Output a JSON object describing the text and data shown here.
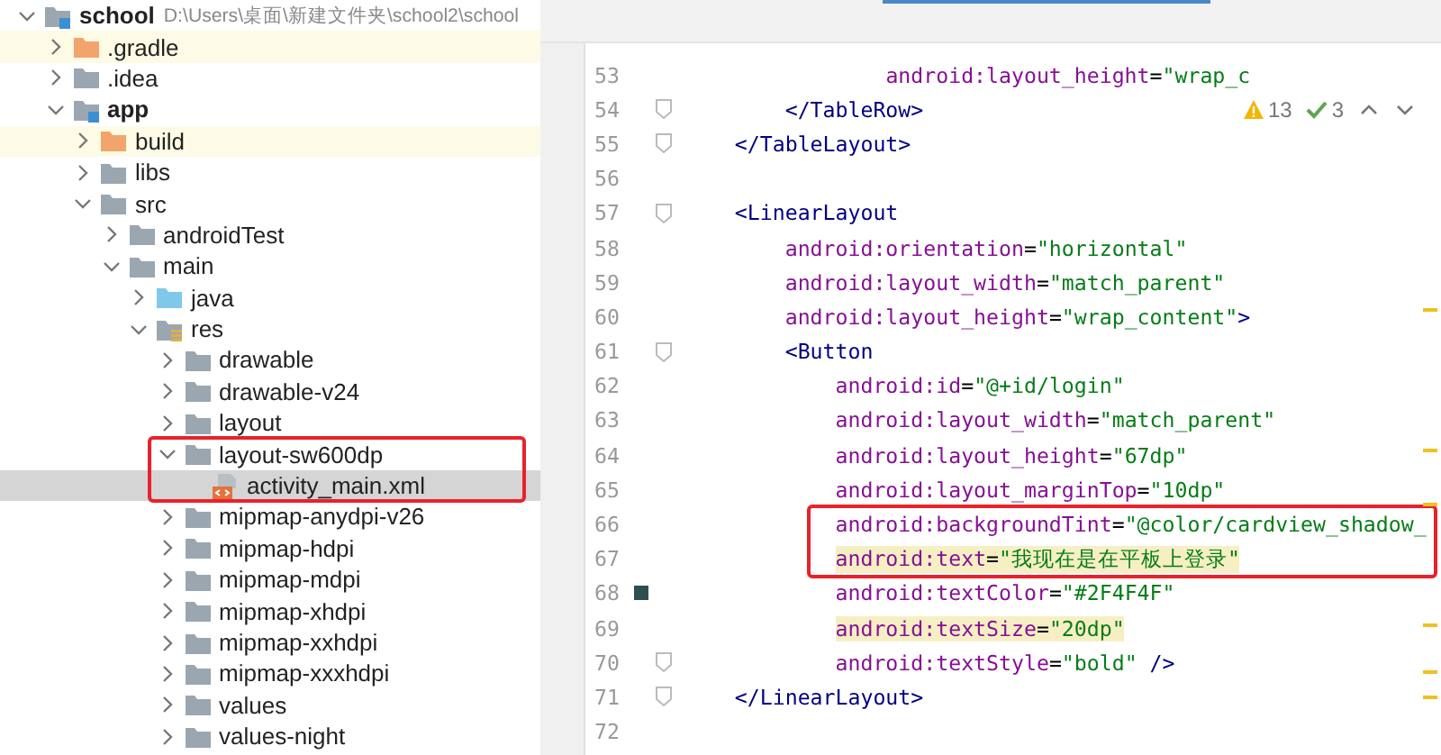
{
  "project_tree": [
    {
      "label": "school",
      "kind": "module",
      "path": "D:\\Users\\桌面\\新建文件夹\\school2\\school",
      "expanded": true,
      "selected": false,
      "children": [
        {
          "label": ".gradle",
          "kind": "excluded",
          "expanded": false,
          "selected": false
        },
        {
          "label": ".idea",
          "kind": "folder",
          "expanded": false,
          "selected": false
        },
        {
          "label": "app",
          "kind": "module",
          "expanded": true,
          "selected": false,
          "children": [
            {
              "label": "build",
              "kind": "excluded",
              "expanded": false,
              "selected": false
            },
            {
              "label": "libs",
              "kind": "folder",
              "expanded": false,
              "selected": false
            },
            {
              "label": "src",
              "kind": "folder",
              "expanded": true,
              "selected": false,
              "children": [
                {
                  "label": "androidTest",
                  "kind": "folder",
                  "expanded": false,
                  "selected": false
                },
                {
                  "label": "main",
                  "kind": "folder",
                  "expanded": true,
                  "selected": false,
                  "children": [
                    {
                      "label": "java",
                      "kind": "source",
                      "expanded": false,
                      "selected": false
                    },
                    {
                      "label": "res",
                      "kind": "resources",
                      "expanded": true,
                      "selected": false,
                      "children": [
                        {
                          "label": "drawable",
                          "kind": "folder",
                          "expanded": false,
                          "selected": false
                        },
                        {
                          "label": "drawable-v24",
                          "kind": "folder",
                          "expanded": false,
                          "selected": false
                        },
                        {
                          "label": "layout",
                          "kind": "folder",
                          "expanded": false,
                          "selected": false
                        },
                        {
                          "label": "layout-sw600dp",
                          "kind": "folder",
                          "expanded": true,
                          "selected": false,
                          "annotated": true,
                          "children": [
                            {
                              "label": "activity_main.xml",
                              "kind": "xml",
                              "selected": true
                            }
                          ]
                        },
                        {
                          "label": "mipmap-anydpi-v26",
                          "kind": "folder",
                          "expanded": false,
                          "selected": false
                        },
                        {
                          "label": "mipmap-hdpi",
                          "kind": "folder",
                          "expanded": false,
                          "selected": false
                        },
                        {
                          "label": "mipmap-mdpi",
                          "kind": "folder",
                          "expanded": false,
                          "selected": false
                        },
                        {
                          "label": "mipmap-xhdpi",
                          "kind": "folder",
                          "expanded": false,
                          "selected": false
                        },
                        {
                          "label": "mipmap-xxhdpi",
                          "kind": "folder",
                          "expanded": false,
                          "selected": false
                        },
                        {
                          "label": "mipmap-xxxhdpi",
                          "kind": "folder",
                          "expanded": false,
                          "selected": false
                        },
                        {
                          "label": "values",
                          "kind": "folder",
                          "expanded": false,
                          "selected": false
                        },
                        {
                          "label": "values-night",
                          "kind": "folder",
                          "expanded": false,
                          "selected": false
                        }
                      ]
                    }
                  ]
                }
              ]
            }
          ]
        }
      ]
    }
  ],
  "editor": {
    "inspections": {
      "warnings": "13",
      "typos": "3"
    },
    "lines": [
      {
        "number": "53",
        "highlighted": false,
        "segments": [
          {
            "kind": "attr",
            "text": "                android:layout_height"
          },
          {
            "kind": "punct",
            "text": "="
          },
          {
            "kind": "value",
            "text": "\"wrap_c"
          }
        ]
      },
      {
        "number": "54",
        "fold": true,
        "highlighted": false,
        "segments": [
          {
            "kind": "tag",
            "text": "        </TableRow>"
          }
        ]
      },
      {
        "number": "55",
        "fold": true,
        "highlighted": false,
        "segments": [
          {
            "kind": "tag",
            "text": "    </TableLayout>"
          }
        ]
      },
      {
        "number": "56"
      },
      {
        "number": "57",
        "fold": true,
        "highlighted": false,
        "segments": [
          {
            "kind": "tag",
            "text": "    <LinearLayout"
          }
        ]
      },
      {
        "number": "58",
        "highlighted": false,
        "segments": [
          {
            "kind": "attr",
            "text": "        android:orientation"
          },
          {
            "kind": "punct",
            "text": "="
          },
          {
            "kind": "value",
            "text": "\"horizontal\""
          }
        ]
      },
      {
        "number": "59",
        "highlighted": false,
        "segments": [
          {
            "kind": "attr",
            "text": "        android:layout_width"
          },
          {
            "kind": "punct",
            "text": "="
          },
          {
            "kind": "value",
            "text": "\"match_parent\""
          }
        ]
      },
      {
        "number": "60",
        "highlighted": false,
        "segments": [
          {
            "kind": "attr",
            "text": "        android:layout_height"
          },
          {
            "kind": "punct",
            "text": "="
          },
          {
            "kind": "value",
            "text": "\"wrap_content\""
          },
          {
            "kind": "tag",
            "text": ">"
          }
        ]
      },
      {
        "number": "61",
        "fold": true,
        "highlighted": false,
        "segments": [
          {
            "kind": "tag",
            "text": "        <Button"
          }
        ]
      },
      {
        "number": "62",
        "highlighted": false,
        "segments": [
          {
            "kind": "attr",
            "text": "            android:id"
          },
          {
            "kind": "punct",
            "text": "="
          },
          {
            "kind": "value",
            "text": "\"@+id/login\""
          }
        ]
      },
      {
        "number": "63",
        "highlighted": false,
        "segments": [
          {
            "kind": "attr",
            "text": "            android:layout_width"
          },
          {
            "kind": "punct",
            "text": "="
          },
          {
            "kind": "value",
            "text": "\"match_parent\""
          }
        ]
      },
      {
        "number": "64",
        "highlighted": false,
        "segments": [
          {
            "kind": "attr",
            "text": "            android:layout_height"
          },
          {
            "kind": "punct",
            "text": "="
          },
          {
            "kind": "value",
            "text": "\"67dp\""
          }
        ]
      },
      {
        "number": "65",
        "highlighted": false,
        "segments": [
          {
            "kind": "attr",
            "text": "            android:layout_marginTop"
          },
          {
            "kind": "punct",
            "text": "="
          },
          {
            "kind": "value",
            "text": "\"10dp\""
          }
        ]
      },
      {
        "number": "66",
        "highlighted": false,
        "annotated": true,
        "segments": [
          {
            "kind": "attr",
            "text": "            android:backgroundTint"
          },
          {
            "kind": "punct",
            "text": "="
          },
          {
            "kind": "value",
            "text": "\"@color/cardview_shadow_"
          }
        ]
      },
      {
        "number": "67",
        "highlighted": true,
        "annotated": true,
        "segments": [
          {
            "kind": "attr",
            "text": "            android:text"
          },
          {
            "kind": "punct",
            "text": "="
          },
          {
            "kind": "value",
            "text": "\"我现在是在平板上登录\""
          }
        ]
      },
      {
        "number": "68",
        "color": "#2f4f4f",
        "highlighted": false,
        "segments": [
          {
            "kind": "attr",
            "text": "            android:textColor"
          },
          {
            "kind": "punct",
            "text": "="
          },
          {
            "kind": "value",
            "text": "\"#2F4F4F\""
          }
        ]
      },
      {
        "number": "69",
        "highlighted": true,
        "segments": [
          {
            "kind": "attr",
            "text": "            android:textSize"
          },
          {
            "kind": "punct",
            "text": "="
          },
          {
            "kind": "value",
            "text": "\"20dp\""
          }
        ]
      },
      {
        "number": "70",
        "fold": true,
        "highlighted": false,
        "segments": [
          {
            "kind": "attr",
            "text": "            android:textStyle"
          },
          {
            "kind": "punct",
            "text": "="
          },
          {
            "kind": "value",
            "text": "\"bold\""
          },
          {
            "kind": "tag",
            "text": " />"
          }
        ]
      },
      {
        "number": "71",
        "fold": true,
        "highlighted": false,
        "segments": [
          {
            "kind": "tag",
            "text": "    </LinearLayout>"
          }
        ]
      },
      {
        "number": "72"
      }
    ]
  }
}
